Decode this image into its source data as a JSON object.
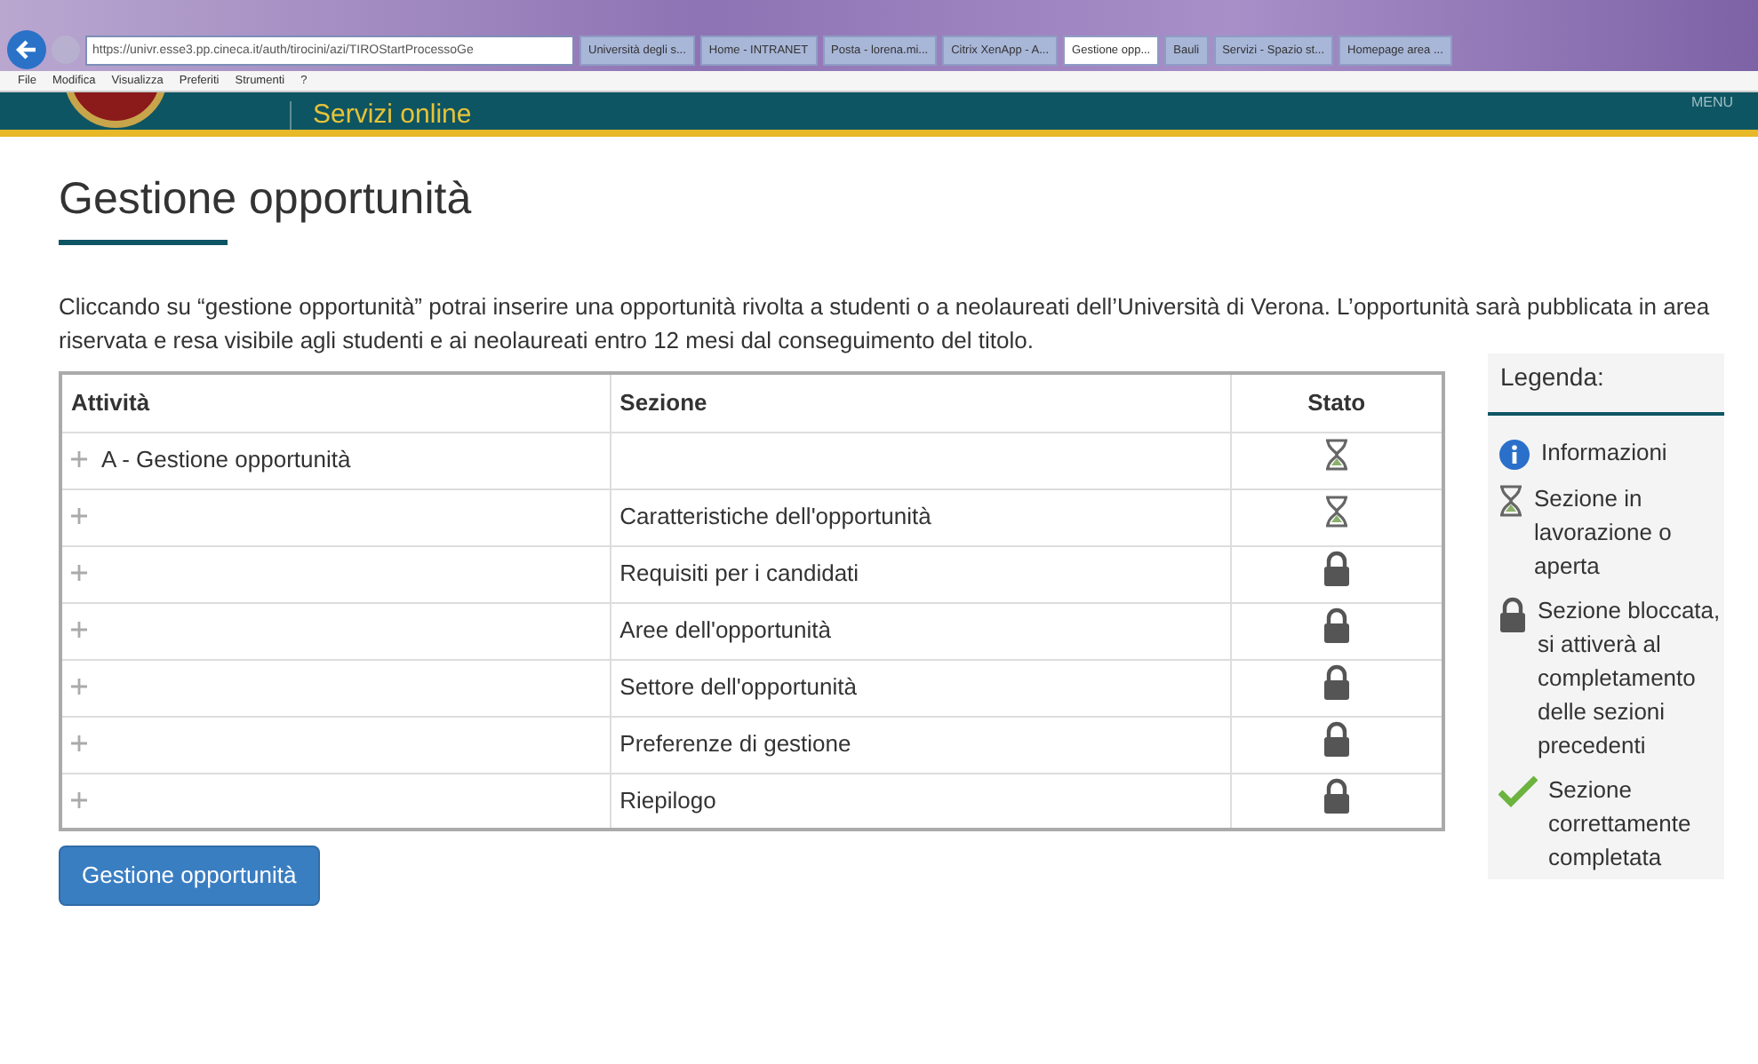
{
  "browser": {
    "address": "https://univr.esse3.pp.cineca.it/auth/tirocini/azi/TIROStartProcessoGe",
    "tabs": [
      {
        "label": "Università degli s...",
        "selected": false
      },
      {
        "label": "Home - INTRANET",
        "selected": false
      },
      {
        "label": "Posta - lorena.mi...",
        "selected": false
      },
      {
        "label": "Citrix XenApp - A...",
        "selected": false
      },
      {
        "label": "Gestione opp...",
        "selected": true
      },
      {
        "label": "Bauli",
        "selected": false
      },
      {
        "label": "Servizi - Spazio st...",
        "selected": false
      },
      {
        "label": "Homepage area ...",
        "selected": false
      }
    ],
    "menu": [
      "File",
      "Modifica",
      "Visualizza",
      "Preferiti",
      "Strumenti",
      "?"
    ]
  },
  "header": {
    "subtitle": "Servizi online",
    "menu": "MENU"
  },
  "title": "Gestione opportunità",
  "intro": "Cliccando su “gestione opportunità” potrai inserire una opportunità rivolta a studenti o a neolaureati dell’Università di Verona. L’opportunità sarà pubblicata in area riservata e resa visibile agli studenti e ai neolaureati entro 12 mesi dal conseguimento del titolo.",
  "table": {
    "columns": [
      "Attività",
      "Sezione",
      "Stato"
    ],
    "rows": [
      {
        "activity": "A - Gestione opportunità",
        "section": "",
        "kind": "hourglass"
      },
      {
        "activity": "",
        "section": "Caratteristiche dell'opportunità",
        "kind": "hourglass"
      },
      {
        "activity": "",
        "section": "Requisiti per i candidati",
        "kind": "lock"
      },
      {
        "activity": "",
        "section": "Aree dell'opportunità",
        "kind": "lock"
      },
      {
        "activity": "",
        "section": "Settore dell'opportunità",
        "kind": "lock"
      },
      {
        "activity": "",
        "section": "Preferenze di gestione",
        "kind": "lock"
      },
      {
        "activity": "",
        "section": "Riepilogo",
        "kind": "lock"
      }
    ]
  },
  "button": "Gestione opportunità",
  "legend": {
    "title": "Legenda:",
    "items": [
      {
        "kind": "info",
        "text": "Informazioni"
      },
      {
        "kind": "hourglass",
        "text": "Sezione in lavorazione o aperta"
      },
      {
        "kind": "lock",
        "text": "Sezione bloccata, si attiverà al completamento delle sezioni precedenti"
      },
      {
        "kind": "check",
        "text": "Sezione correttamente completata"
      }
    ]
  }
}
